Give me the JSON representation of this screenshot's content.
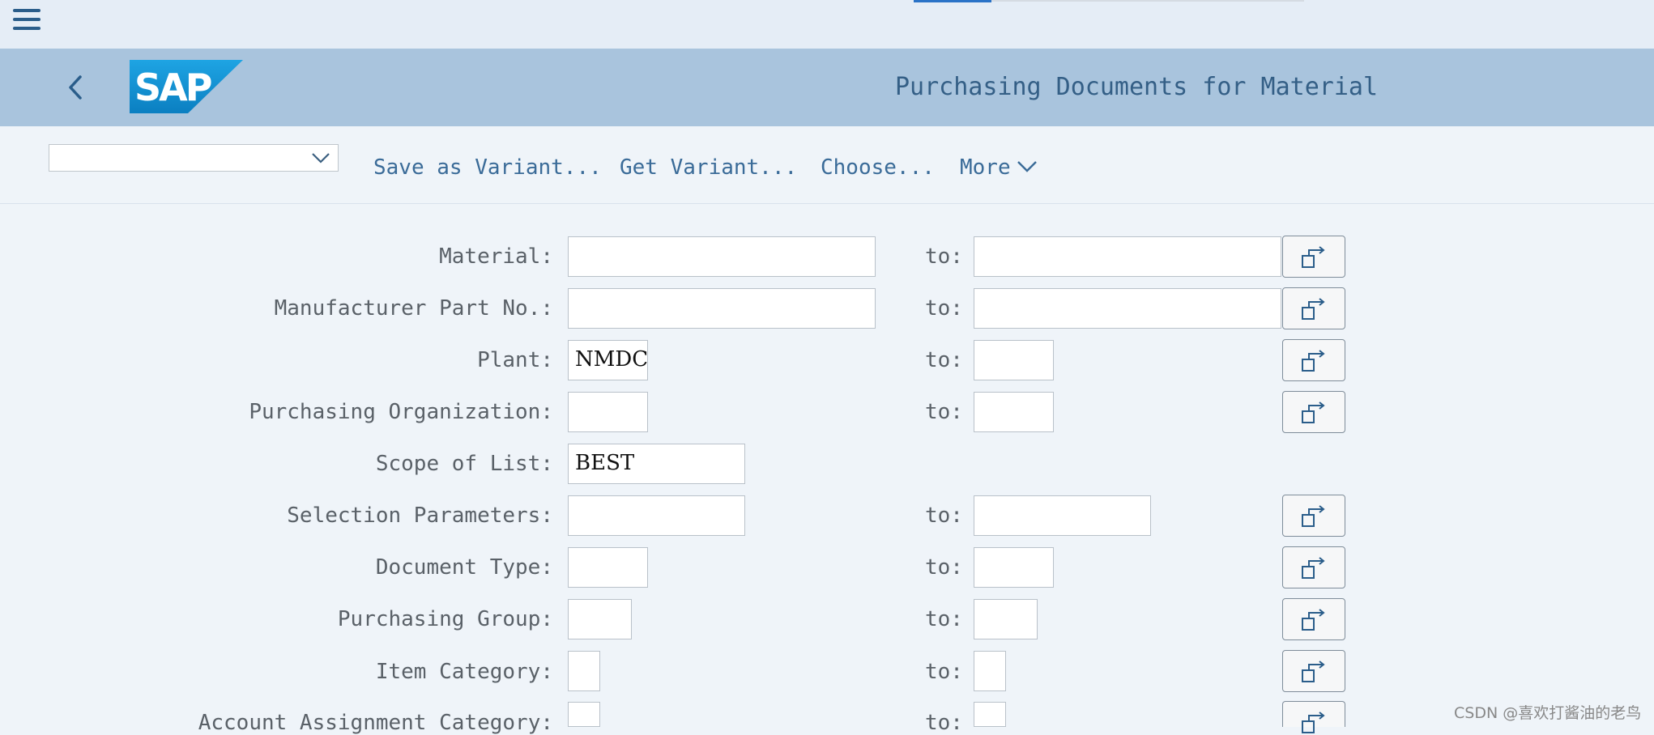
{
  "header": {
    "title": "Purchasing Documents for Material",
    "logo_text": "SAP"
  },
  "toolbar": {
    "variant_value": "",
    "save_variant": "Save as Variant...",
    "get_variant": "Get Variant...",
    "choose": "Choose...",
    "more": "More"
  },
  "form": {
    "to_label": "to:",
    "rows": [
      {
        "label": "Material:",
        "from": "",
        "to": ""
      },
      {
        "label": "Manufacturer Part No.:",
        "from": "",
        "to": ""
      },
      {
        "label": "Plant:",
        "from": "NMDC",
        "to": ""
      },
      {
        "label": "Purchasing Organization:",
        "from": "",
        "to": ""
      },
      {
        "label": "Scope of List:",
        "from": "BEST"
      },
      {
        "label": "Selection Parameters:",
        "from": "",
        "to": ""
      },
      {
        "label": "Document Type:",
        "from": "",
        "to": ""
      },
      {
        "label": "Purchasing Group:",
        "from": "",
        "to": ""
      },
      {
        "label": "Item Category:",
        "from": "",
        "to": ""
      },
      {
        "label": "Account Assignment Category:",
        "from": "",
        "to": ""
      }
    ]
  },
  "icons": {
    "menu": "hamburger-menu-icon",
    "back": "chevron-left-icon",
    "dropdown": "chevron-down-icon",
    "multiple_selection": "multiple-selection-icon"
  },
  "colors": {
    "header_bg": "#a9c4dd",
    "topbar_bg": "#e5edf6",
    "page_bg": "#eff4f9",
    "link": "#3a6b98",
    "sap_blue": "#1a9fde"
  },
  "watermark": "CSDN @喜欢打酱油的老鸟"
}
